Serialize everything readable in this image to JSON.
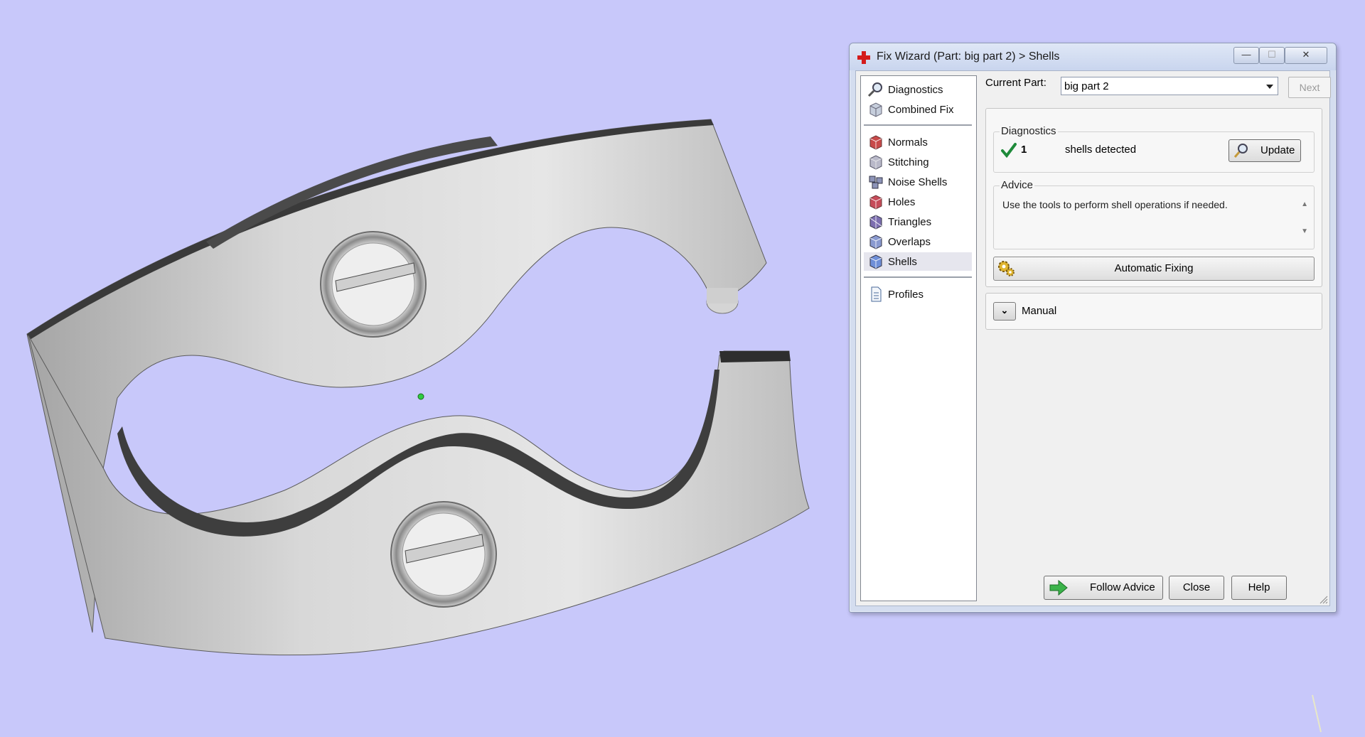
{
  "window": {
    "title": "Fix Wizard (Part: big part 2) > Shells",
    "minimize": "—",
    "maximize": "☐",
    "close": "✕"
  },
  "nav": {
    "top_items": [
      {
        "label": "Diagnostics",
        "icon": "magnifier-icon"
      },
      {
        "label": "Combined Fix",
        "icon": "box-icon"
      }
    ],
    "fix_items": [
      {
        "label": "Normals",
        "icon": "normals-cube-icon"
      },
      {
        "label": "Stitching",
        "icon": "stitching-cube-icon"
      },
      {
        "label": "Noise Shells",
        "icon": "noise-shells-icon"
      },
      {
        "label": "Holes",
        "icon": "holes-cube-icon"
      },
      {
        "label": "Triangles",
        "icon": "triangles-cube-icon"
      },
      {
        "label": "Overlaps",
        "icon": "overlaps-cube-icon"
      },
      {
        "label": "Shells",
        "icon": "shells-cube-icon",
        "active": true
      }
    ],
    "bottom_items": [
      {
        "label": "Profiles",
        "icon": "document-icon"
      }
    ]
  },
  "current_part": {
    "label": "Current Part:",
    "value": "big part 2",
    "next_label": "Next"
  },
  "diagnostics": {
    "legend": "Diagnostics",
    "count": "1",
    "text": "shells detected",
    "update_label": "Update"
  },
  "advice": {
    "legend": "Advice",
    "text": "Use the tools to perform shell operations if needed."
  },
  "automatic_fixing_label": "Automatic Fixing",
  "manual_label": "Manual",
  "buttons": {
    "follow_advice": "Follow Advice",
    "close": "Close",
    "help": "Help"
  },
  "colors": {
    "viewport_background": "#c8c8fa",
    "model_gray": "#c9c9c9",
    "pivot_point": "#2ecc40"
  }
}
